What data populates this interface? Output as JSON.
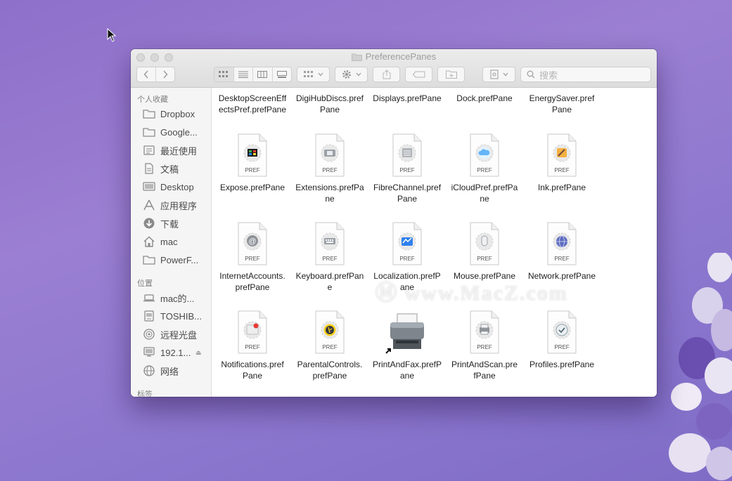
{
  "window": {
    "title": "PreferencePanes"
  },
  "toolbar": {
    "search_placeholder": "搜索",
    "back_icon": "chevron-left-icon",
    "forward_icon": "chevron-right-icon"
  },
  "sidebar": {
    "favorites_header": "个人收藏",
    "favorites": [
      {
        "label": "Dropbox",
        "icon": "folder-icon"
      },
      {
        "label": "Google...",
        "icon": "folder-icon"
      },
      {
        "label": "最近使用",
        "icon": "recents-icon"
      },
      {
        "label": "文稿",
        "icon": "documents-icon"
      },
      {
        "label": "Desktop",
        "icon": "desktop-icon"
      },
      {
        "label": "应用程序",
        "icon": "applications-icon"
      },
      {
        "label": "下载",
        "icon": "download-icon"
      },
      {
        "label": "mac",
        "icon": "home-icon"
      },
      {
        "label": "PowerF...",
        "icon": "folder-icon"
      }
    ],
    "locations_header": "位置",
    "locations": [
      {
        "label": "mac的...",
        "icon": "laptop-icon"
      },
      {
        "label": "TOSHIB...",
        "icon": "drive-icon"
      },
      {
        "label": "远程光盘",
        "icon": "disc-icon"
      },
      {
        "label": "192.1...",
        "icon": "server-icon"
      },
      {
        "label": "网络",
        "icon": "network-icon"
      }
    ],
    "tags_header": "标签"
  },
  "files": {
    "row0": [
      {
        "line1": "DesktopScreenEff",
        "line2": "ectsPref.prefPane"
      },
      {
        "line1": "DigiHubDiscs.pref",
        "line2": "Pane"
      },
      {
        "line1": "Displays.prefPane",
        "line2": ""
      },
      {
        "line1": "Dock.prefPane",
        "line2": ""
      },
      {
        "line1": "EnergySaver.pref",
        "line2": "Pane"
      }
    ],
    "rows": [
      [
        {
          "line1": "Expose.prefPane",
          "line2": "",
          "badge": "PREF",
          "glyph": "expose"
        },
        {
          "line1": "Extensions.prefPa",
          "line2": "ne",
          "badge": "PREF",
          "glyph": "extensions"
        },
        {
          "line1": "FibreChannel.pref",
          "line2": "Pane",
          "badge": "PREF",
          "glyph": "fibre"
        },
        {
          "line1": "iCloudPref.prefPa",
          "line2": "ne",
          "badge": "PREF",
          "glyph": "icloud"
        },
        {
          "line1": "Ink.prefPane",
          "line2": "",
          "badge": "PREF",
          "glyph": "ink"
        }
      ],
      [
        {
          "line1": "InternetAccounts.",
          "line2": "prefPane",
          "badge": "PREF",
          "glyph": "internet"
        },
        {
          "line1": "Keyboard.prefPan",
          "line2": "e",
          "badge": "PREF",
          "glyph": "keyboard"
        },
        {
          "line1": "Localization.prefP",
          "line2": "ane",
          "badge": "PREF",
          "glyph": "localization"
        },
        {
          "line1": "Mouse.prefPane",
          "line2": "",
          "badge": "PREF",
          "glyph": "mouse"
        },
        {
          "line1": "Network.prefPane",
          "line2": "",
          "badge": "PREF",
          "glyph": "network"
        }
      ],
      [
        {
          "line1": "Notifications.pref",
          "line2": "Pane",
          "badge": "PREF",
          "glyph": "notifications"
        },
        {
          "line1": "ParentalControls.",
          "line2": "prefPane",
          "badge": "PREF",
          "glyph": "parental"
        },
        {
          "line1": "PrintAndFax.prefP",
          "line2": "ane",
          "badge": "",
          "glyph": "printer-alias"
        },
        {
          "line1": "PrintAndScan.pre",
          "line2": "fPane",
          "badge": "PREF",
          "glyph": "printscan"
        },
        {
          "line1": "Profiles.prefPane",
          "line2": "",
          "badge": "PREF",
          "glyph": "profiles"
        }
      ]
    ]
  },
  "watermark": "Ⓜ www.MacZ.com"
}
